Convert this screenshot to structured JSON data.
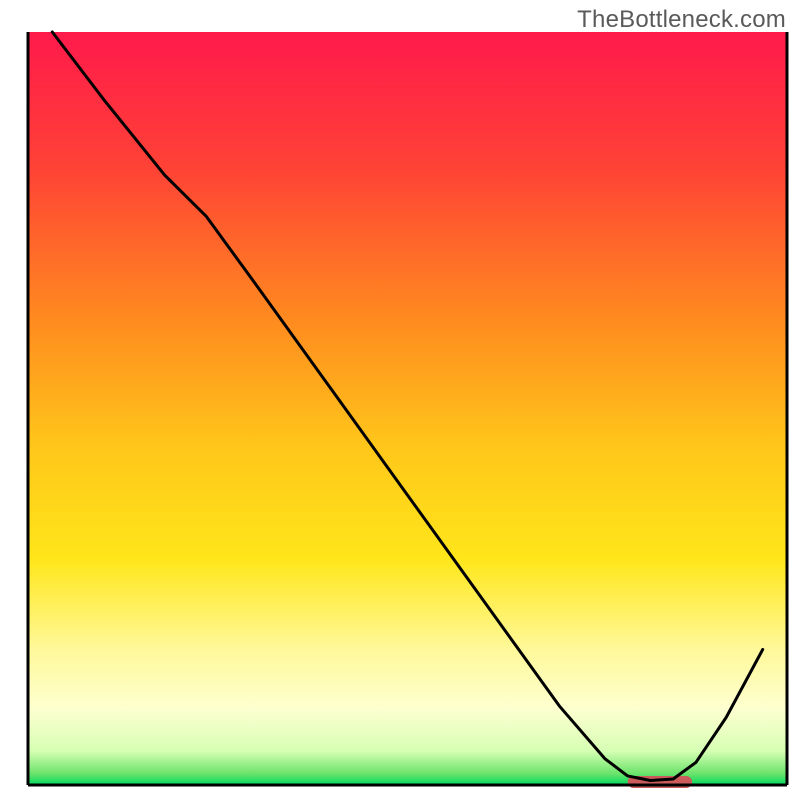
{
  "watermark": "TheBottleneck.com",
  "chart_data": {
    "type": "line",
    "title": "",
    "xlabel": "",
    "ylabel": "",
    "xlim": [
      0,
      100
    ],
    "ylim": [
      0,
      100
    ],
    "annotation_note": "x and y are normalized 0–100 across the visible plot area; no axis ticks/labels are rendered in the source image",
    "gradient_stops": [
      {
        "offset": 0.0,
        "color": "#ff1a4b"
      },
      {
        "offset": 0.18,
        "color": "#ff4236"
      },
      {
        "offset": 0.38,
        "color": "#ff8a1f"
      },
      {
        "offset": 0.55,
        "color": "#ffc61a"
      },
      {
        "offset": 0.7,
        "color": "#ffe61a"
      },
      {
        "offset": 0.82,
        "color": "#fff99a"
      },
      {
        "offset": 0.9,
        "color": "#fdffd0"
      },
      {
        "offset": 0.955,
        "color": "#d6ffb3"
      },
      {
        "offset": 0.985,
        "color": "#6be36b"
      },
      {
        "offset": 1.0,
        "color": "#00d95f"
      }
    ],
    "series": [
      {
        "name": "bottleneck-curve",
        "color": "#000000",
        "stroke_width": 3,
        "x": [
          3.2,
          10,
          18,
          23.5,
          30,
          40,
          50,
          60,
          70,
          76,
          79,
          82,
          85,
          88,
          92,
          96.8
        ],
        "y": [
          100,
          91,
          81,
          75.5,
          66.5,
          52.5,
          38.5,
          24.5,
          10.5,
          3.5,
          1.2,
          0.6,
          0.8,
          3,
          9,
          18
        ]
      }
    ],
    "marker": {
      "name": "optimal-range-marker",
      "color": "#cc5b5b",
      "x_start": 79,
      "x_end": 87.5,
      "y": 0.4,
      "thickness_pct": 1.6
    },
    "border": {
      "show_top": false,
      "show_right": true,
      "show_bottom": true,
      "show_left": true,
      "color": "#000000",
      "width": 3
    }
  }
}
